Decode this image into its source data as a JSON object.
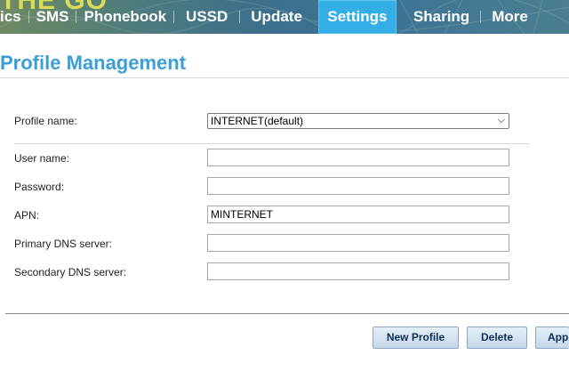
{
  "brand": {
    "text": "THE GO"
  },
  "nav": {
    "tabs": [
      {
        "label": "ics"
      },
      {
        "label": "SMS"
      },
      {
        "label": "Phonebook"
      },
      {
        "label": "USSD"
      },
      {
        "label": "Update"
      },
      {
        "label": "Settings",
        "active": true
      },
      {
        "label": "Sharing"
      },
      {
        "label": "More"
      }
    ]
  },
  "page": {
    "title": "Profile Management"
  },
  "form": {
    "profile_name": {
      "label": "Profile name:",
      "value": "INTERNET(default)"
    },
    "user_name": {
      "label": "User name:",
      "value": ""
    },
    "password": {
      "label": "Password:",
      "value": ""
    },
    "apn": {
      "label": "APN:",
      "value": "MINTERNET"
    },
    "primary_dns": {
      "label": "Primary DNS server:",
      "value": ""
    },
    "secondary_dns": {
      "label": "Secondary DNS server:",
      "value": ""
    }
  },
  "buttons": {
    "new_profile": "New Profile",
    "delete": "Delete",
    "apply": "App"
  },
  "colors": {
    "accent": "#33aee6",
    "title": "#3a9ed9",
    "brand_text": "#d9dc54"
  }
}
